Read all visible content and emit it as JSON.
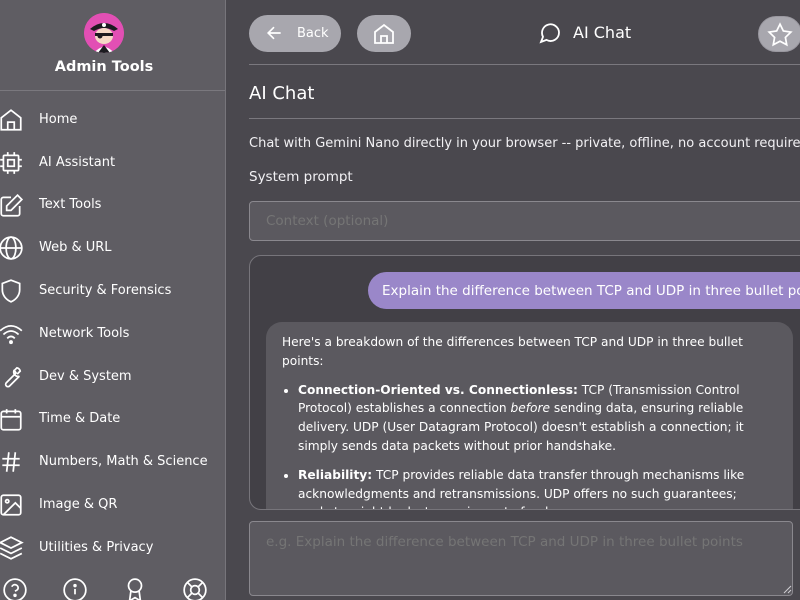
{
  "colors": {
    "sidebar_bg": "#5f5d63",
    "main_bg": "#4a484e",
    "button_bg": "#a8a7ae",
    "user_bubble": "#9a87c9",
    "bot_bubble": "#5b595f",
    "avatar_bg": "#e24fb4"
  },
  "sidebar": {
    "brand": "Admin Tools",
    "items": [
      {
        "label": "Home",
        "icon": "home-icon"
      },
      {
        "label": "AI Assistant",
        "icon": "chip-icon"
      },
      {
        "label": "Text Tools",
        "icon": "edit-icon"
      },
      {
        "label": "Web & URL",
        "icon": "globe-icon"
      },
      {
        "label": "Security & Forensics",
        "icon": "shield-icon"
      },
      {
        "label": "Network Tools",
        "icon": "wifi-icon"
      },
      {
        "label": "Dev & System",
        "icon": "wrench-icon"
      },
      {
        "label": "Time & Date",
        "icon": "calendar-icon"
      },
      {
        "label": "Numbers, Math & Science",
        "icon": "hash-icon"
      },
      {
        "label": "Image & QR",
        "icon": "image-icon"
      },
      {
        "label": "Utilities & Privacy",
        "icon": "layers-icon"
      }
    ],
    "footer_icons": [
      "help-icon",
      "info-icon",
      "award-icon",
      "lifebuoy-icon"
    ]
  },
  "header": {
    "back_label": "Back",
    "title": "AI Chat"
  },
  "page": {
    "title": "AI Chat",
    "description": "Chat with Gemini Nano directly in your browser -- private, offline, no account required.",
    "system_prompt_label": "System prompt",
    "context_placeholder": "Context (optional)",
    "message_placeholder": "e.g. Explain the difference between TCP and UDP in three bullet points"
  },
  "chat": {
    "user_message": "Explain the difference between TCP and UDP in three bullet points",
    "bot_intro": "Here's a breakdown of the differences between TCP and UDP in three bullet points:",
    "bullets": [
      {
        "title": "Connection-Oriented vs. Connectionless:",
        "text_a": " TCP (Transmission Control Protocol) establishes a connection ",
        "emph": "before",
        "text_b": " sending data, ensuring reliable delivery. UDP (User Datagram Protocol) doesn't establish a connection; it simply sends data packets without prior handshake."
      },
      {
        "title": "Reliability:",
        "text_a": " TCP provides reliable data transfer through mechanisms like acknowledgments and retransmissions. UDP offers no such guarantees; packets might be lost or arrive out of order."
      }
    ]
  }
}
